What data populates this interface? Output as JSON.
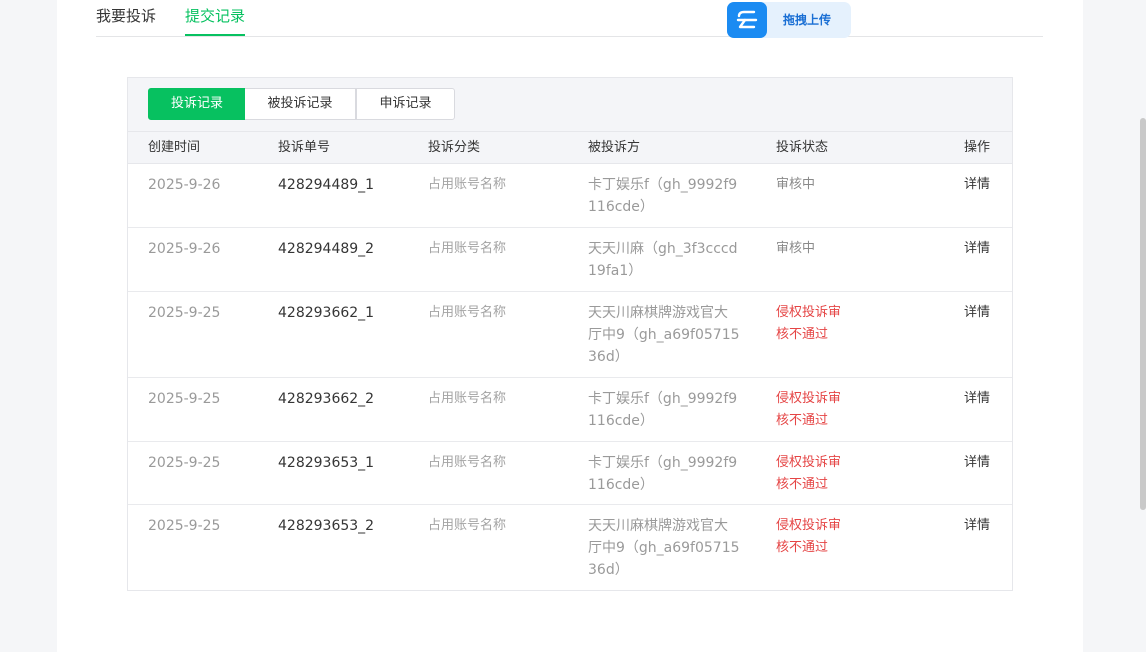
{
  "tabs": [
    {
      "label": "我要投诉"
    },
    {
      "label": "提交记录"
    }
  ],
  "upload": {
    "label": "拖拽上传"
  },
  "segments": [
    {
      "label": "投诉记录"
    },
    {
      "label": "被投诉记录"
    },
    {
      "label": "申诉记录"
    }
  ],
  "table": {
    "headers": [
      "创建时间",
      "投诉单号",
      "投诉分类",
      "被投诉方",
      "投诉状态",
      "操作"
    ],
    "rows": [
      {
        "date": "2025-9-26",
        "no": "428294489_1",
        "category": "占用账号名称",
        "party": [
          "卡丁娱乐f（gh_9992f9",
          "116cde）"
        ],
        "status": [
          "审核中"
        ],
        "action": "详情"
      },
      {
        "date": "2025-9-26",
        "no": "428294489_2",
        "category": "占用账号名称",
        "party": [
          "天天川麻（gh_3f3cccd",
          "19fa1）"
        ],
        "status": [
          "审核中"
        ],
        "action": "详情"
      },
      {
        "date": "2025-9-25",
        "no": "428293662_1",
        "category": "占用账号名称",
        "party": [
          "天天川麻棋牌游戏官大",
          "厅中9（gh_a69f05715",
          "36d）"
        ],
        "status": [
          "侵权投诉审",
          "核不通过"
        ],
        "action": "详情"
      },
      {
        "date": "2025-9-25",
        "no": "428293662_2",
        "category": "占用账号名称",
        "party": [
          "卡丁娱乐f（gh_9992f9",
          "116cde）"
        ],
        "status": [
          "侵权投诉审",
          "核不通过"
        ],
        "action": "详情"
      },
      {
        "date": "2025-9-25",
        "no": "428293653_1",
        "category": "占用账号名称",
        "party": [
          "卡丁娱乐f（gh_9992f9",
          "116cde）"
        ],
        "status": [
          "侵权投诉审",
          "核不通过"
        ],
        "action": "详情"
      },
      {
        "date": "2025-9-25",
        "no": "428293653_2",
        "category": "占用账号名称",
        "party": [
          "天天川麻棋牌游戏官大",
          "厅中9（gh_a69f05715",
          "36d）"
        ],
        "status": [
          "侵权投诉审",
          "核不通过"
        ],
        "action": "详情"
      }
    ]
  },
  "colors": {
    "accent": "#07c160",
    "fail": "#e54545",
    "upload_blue": "#1b8bf2"
  },
  "icons": {
    "upload": "cloud-upload-icon"
  }
}
